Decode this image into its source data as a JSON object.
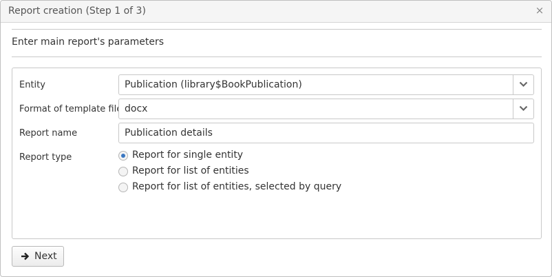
{
  "window": {
    "title": "Report creation (Step 1 of 3)",
    "close_glyph": "×"
  },
  "step": {
    "header": "Enter main report's parameters"
  },
  "form": {
    "entity": {
      "label": "Entity",
      "value": "Publication (library$BookPublication)"
    },
    "template_format": {
      "label": "Format of template file",
      "value": "docx"
    },
    "report_name": {
      "label": "Report name",
      "value": "Publication details"
    },
    "report_type": {
      "label": "Report type",
      "options": [
        {
          "label": "Report for single entity",
          "checked": true
        },
        {
          "label": "Report for list of entities",
          "checked": false
        },
        {
          "label": "Report for list of entities, selected by query",
          "checked": false
        }
      ]
    }
  },
  "buttons": {
    "next": {
      "label": "Next",
      "icon": "arrow-right-icon"
    }
  },
  "colors": {
    "radio_checked": "#3b78c2",
    "border": "#c8c8c8",
    "title_bar": "#f5f5f5"
  }
}
